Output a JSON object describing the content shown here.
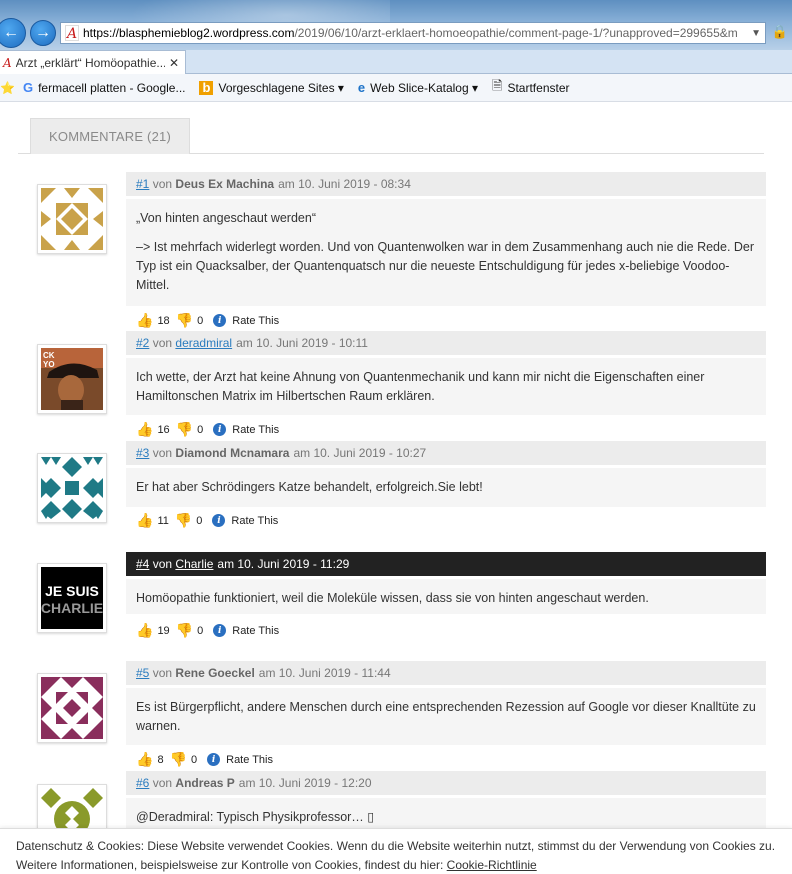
{
  "browser": {
    "url_prefix": "https://",
    "url_host": "blasphemieblog2.wordpress.com",
    "url_rest": "/2019/06/10/arzt-erklaert-homoeopathie/comment-page-1/?unapproved=299655&m",
    "tab_title": "Arzt „erklärt“ Homöopathie...",
    "favorites": [
      {
        "icon": "google-icon",
        "label": "fermacell platten - Google..."
      },
      {
        "icon": "bing-icon",
        "label": "Vorgeschlagene Sites ▾"
      },
      {
        "icon": "ie-icon",
        "label": "Web Slice-Katalog ▾"
      },
      {
        "icon": "page-icon",
        "label": "Startfenster"
      }
    ]
  },
  "comments_tab": "KOMMENTARE (21)",
  "comments": [
    {
      "num": "#1",
      "by": "von",
      "author": "Deus Ex Machina",
      "author_link": false,
      "date": "am 10. Juni 2019 - 08:34",
      "paragraphs": [
        "„Von hinten angeschaut werden“",
        "–> Ist mehrfach widerlegt worden. Und von Quantenwolken war in dem Zusammenhang auch nie die Rede. Der Typ ist ein Quacksalber, der Quantenquatsch nur die neueste Entschuldigung für jedes x-beliebige Voodoo-Mittel."
      ],
      "up": "18",
      "down": "0",
      "rate": "Rate This",
      "avatar_color": "#c9a24a",
      "dark": false
    },
    {
      "num": "#2",
      "by": "von",
      "author": "deradmiral",
      "author_link": true,
      "date": "am 10. Juni 2019 - 10:11",
      "paragraphs": [
        "Ich wette, der Arzt hat keine Ahnung von Quantenmechanik und kann mir nicht die Eigenschaften einer Hamiltonschen Matrix im Hilbertschen Raum erklären."
      ],
      "up": "16",
      "down": "0",
      "rate": "Rate This",
      "avatar_color": "#6b3a22",
      "dark": false,
      "avatar_text": "CK YO"
    },
    {
      "num": "#3",
      "by": "von",
      "author": "Diamond Mcnamara",
      "author_link": false,
      "date": "am 10. Juni 2019 - 10:27",
      "paragraphs": [
        "Er hat aber Schrödingers Katze behandelt, erfolgreich.Sie lebt!"
      ],
      "up": "11",
      "down": "0",
      "rate": "Rate This",
      "avatar_color": "#1f7a86",
      "dark": false
    },
    {
      "num": "#4",
      "by": "von",
      "author": "Charlie",
      "author_link": true,
      "date": "am 10. Juni 2019 - 11:29",
      "paragraphs": [
        "Homöopathie funktioniert, weil die Moleküle wissen, dass sie von hinten angeschaut werden."
      ],
      "up": "19",
      "down": "0",
      "rate": "Rate This",
      "avatar_color": "#000000",
      "dark": true,
      "avatar_text_1": "JE SUIS",
      "avatar_text_2": "CHARLIE"
    },
    {
      "num": "#5",
      "by": "von",
      "author": "Rene Goeckel",
      "author_link": false,
      "date": "am 10. Juni 2019 - 11:44",
      "paragraphs": [
        "Es ist Bürgerpflicht, andere Menschen durch eine entsprechenden Rezession auf Google vor dieser Knalltüte zu warnen."
      ],
      "up": "8",
      "down": "0",
      "rate": "Rate This",
      "avatar_color": "#8a2e5c",
      "dark": false
    },
    {
      "num": "#6",
      "by": "von",
      "author": "Andreas P",
      "author_link": false,
      "date": "am 10. Juni 2019 - 12:20",
      "paragraphs": [
        "@Deradmiral: Typisch Physikprofessor… ▯"
      ],
      "up": "",
      "down": "",
      "rate": "",
      "avatar_color": "#8a9a2a",
      "dark": false
    }
  ],
  "cookie_notice": {
    "line1": "Datenschutz & Cookies: Diese Website verwendet Cookies. Wenn du die Website weiterhin nutzt, stimmst du der Verwendung von Cookies zu.",
    "line2_prefix": "Weitere Informationen, beispielsweise zur Kontrolle von Cookies, findest du hier: ",
    "link": "Cookie-Richtlinie"
  }
}
